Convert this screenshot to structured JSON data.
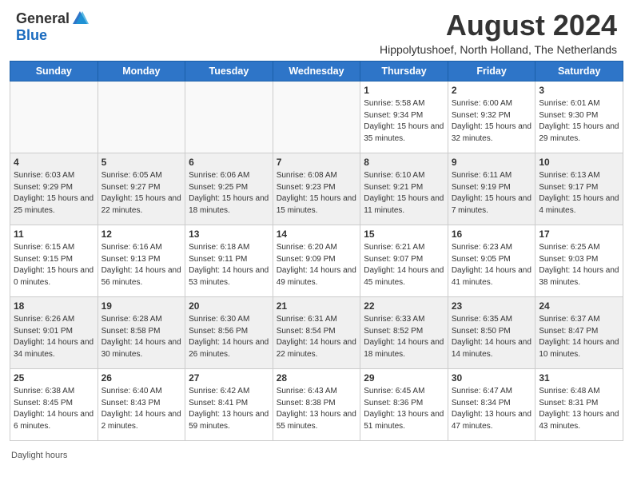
{
  "header": {
    "logo_general": "General",
    "logo_blue": "Blue",
    "title": "August 2024",
    "subtitle": "Hippolytushoef, North Holland, The Netherlands"
  },
  "days_of_week": [
    "Sunday",
    "Monday",
    "Tuesday",
    "Wednesday",
    "Thursday",
    "Friday",
    "Saturday"
  ],
  "weeks": [
    [
      {
        "day": "",
        "info": ""
      },
      {
        "day": "",
        "info": ""
      },
      {
        "day": "",
        "info": ""
      },
      {
        "day": "",
        "info": ""
      },
      {
        "day": "1",
        "info": "Sunrise: 5:58 AM\nSunset: 9:34 PM\nDaylight: 15 hours and 35 minutes."
      },
      {
        "day": "2",
        "info": "Sunrise: 6:00 AM\nSunset: 9:32 PM\nDaylight: 15 hours and 32 minutes."
      },
      {
        "day": "3",
        "info": "Sunrise: 6:01 AM\nSunset: 9:30 PM\nDaylight: 15 hours and 29 minutes."
      }
    ],
    [
      {
        "day": "4",
        "info": "Sunrise: 6:03 AM\nSunset: 9:29 PM\nDaylight: 15 hours and 25 minutes."
      },
      {
        "day": "5",
        "info": "Sunrise: 6:05 AM\nSunset: 9:27 PM\nDaylight: 15 hours and 22 minutes."
      },
      {
        "day": "6",
        "info": "Sunrise: 6:06 AM\nSunset: 9:25 PM\nDaylight: 15 hours and 18 minutes."
      },
      {
        "day": "7",
        "info": "Sunrise: 6:08 AM\nSunset: 9:23 PM\nDaylight: 15 hours and 15 minutes."
      },
      {
        "day": "8",
        "info": "Sunrise: 6:10 AM\nSunset: 9:21 PM\nDaylight: 15 hours and 11 minutes."
      },
      {
        "day": "9",
        "info": "Sunrise: 6:11 AM\nSunset: 9:19 PM\nDaylight: 15 hours and 7 minutes."
      },
      {
        "day": "10",
        "info": "Sunrise: 6:13 AM\nSunset: 9:17 PM\nDaylight: 15 hours and 4 minutes."
      }
    ],
    [
      {
        "day": "11",
        "info": "Sunrise: 6:15 AM\nSunset: 9:15 PM\nDaylight: 15 hours and 0 minutes."
      },
      {
        "day": "12",
        "info": "Sunrise: 6:16 AM\nSunset: 9:13 PM\nDaylight: 14 hours and 56 minutes."
      },
      {
        "day": "13",
        "info": "Sunrise: 6:18 AM\nSunset: 9:11 PM\nDaylight: 14 hours and 53 minutes."
      },
      {
        "day": "14",
        "info": "Sunrise: 6:20 AM\nSunset: 9:09 PM\nDaylight: 14 hours and 49 minutes."
      },
      {
        "day": "15",
        "info": "Sunrise: 6:21 AM\nSunset: 9:07 PM\nDaylight: 14 hours and 45 minutes."
      },
      {
        "day": "16",
        "info": "Sunrise: 6:23 AM\nSunset: 9:05 PM\nDaylight: 14 hours and 41 minutes."
      },
      {
        "day": "17",
        "info": "Sunrise: 6:25 AM\nSunset: 9:03 PM\nDaylight: 14 hours and 38 minutes."
      }
    ],
    [
      {
        "day": "18",
        "info": "Sunrise: 6:26 AM\nSunset: 9:01 PM\nDaylight: 14 hours and 34 minutes."
      },
      {
        "day": "19",
        "info": "Sunrise: 6:28 AM\nSunset: 8:58 PM\nDaylight: 14 hours and 30 minutes."
      },
      {
        "day": "20",
        "info": "Sunrise: 6:30 AM\nSunset: 8:56 PM\nDaylight: 14 hours and 26 minutes."
      },
      {
        "day": "21",
        "info": "Sunrise: 6:31 AM\nSunset: 8:54 PM\nDaylight: 14 hours and 22 minutes."
      },
      {
        "day": "22",
        "info": "Sunrise: 6:33 AM\nSunset: 8:52 PM\nDaylight: 14 hours and 18 minutes."
      },
      {
        "day": "23",
        "info": "Sunrise: 6:35 AM\nSunset: 8:50 PM\nDaylight: 14 hours and 14 minutes."
      },
      {
        "day": "24",
        "info": "Sunrise: 6:37 AM\nSunset: 8:47 PM\nDaylight: 14 hours and 10 minutes."
      }
    ],
    [
      {
        "day": "25",
        "info": "Sunrise: 6:38 AM\nSunset: 8:45 PM\nDaylight: 14 hours and 6 minutes."
      },
      {
        "day": "26",
        "info": "Sunrise: 6:40 AM\nSunset: 8:43 PM\nDaylight: 14 hours and 2 minutes."
      },
      {
        "day": "27",
        "info": "Sunrise: 6:42 AM\nSunset: 8:41 PM\nDaylight: 13 hours and 59 minutes."
      },
      {
        "day": "28",
        "info": "Sunrise: 6:43 AM\nSunset: 8:38 PM\nDaylight: 13 hours and 55 minutes."
      },
      {
        "day": "29",
        "info": "Sunrise: 6:45 AM\nSunset: 8:36 PM\nDaylight: 13 hours and 51 minutes."
      },
      {
        "day": "30",
        "info": "Sunrise: 6:47 AM\nSunset: 8:34 PM\nDaylight: 13 hours and 47 minutes."
      },
      {
        "day": "31",
        "info": "Sunrise: 6:48 AM\nSunset: 8:31 PM\nDaylight: 13 hours and 43 minutes."
      }
    ]
  ],
  "footer": {
    "daylight_label": "Daylight hours"
  }
}
